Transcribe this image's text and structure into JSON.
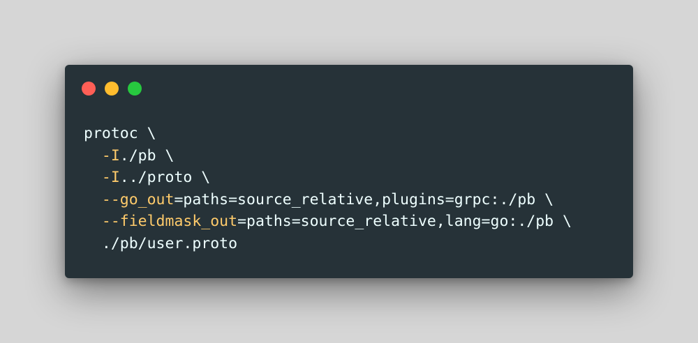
{
  "colors": {
    "background": "#d6d6d6",
    "window": "#263238",
    "text": "#eeffff",
    "flag": "#ffcb6b",
    "close": "#ff5f56",
    "minimize": "#ffbd2e",
    "maximize": "#27c93f"
  },
  "window_controls": [
    "close-dot",
    "minimize-dot",
    "maximize-dot"
  ],
  "code": [
    {
      "indent": "",
      "flag": "",
      "rest": "protoc \\"
    },
    {
      "indent": "  ",
      "flag": "-I",
      "rest": "./pb \\"
    },
    {
      "indent": "  ",
      "flag": "-I",
      "rest": "../proto \\"
    },
    {
      "indent": "  ",
      "flag": "--go_out",
      "rest": "=paths=source_relative,plugins=grpc:./pb \\"
    },
    {
      "indent": "  ",
      "flag": "--fieldmask_out",
      "rest": "=paths=source_relative,lang=go:./pb \\"
    },
    {
      "indent": "  ",
      "flag": "",
      "rest": "./pb/user.proto"
    }
  ]
}
